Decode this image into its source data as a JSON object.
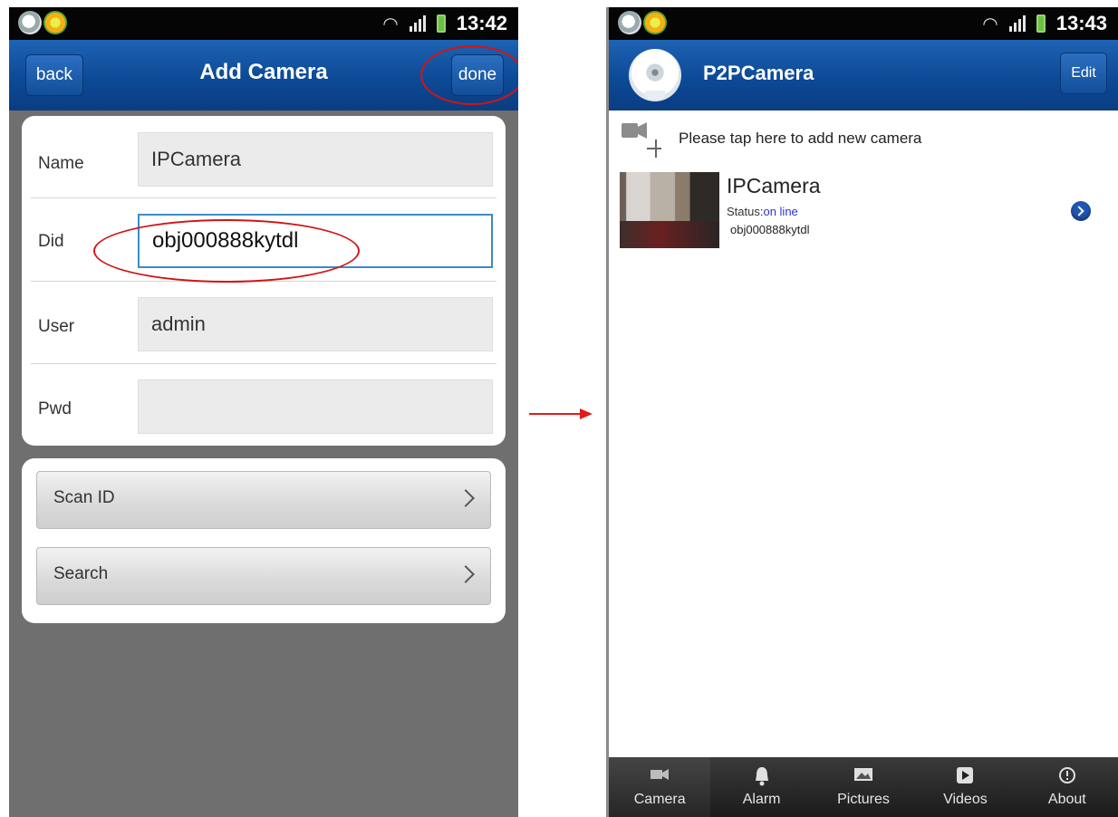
{
  "left_screen": {
    "status_time": "13:42",
    "title": "Add Camera",
    "back_label": "back",
    "done_label": "done",
    "fields": [
      {
        "label": "Name",
        "value": "IPCamera"
      },
      {
        "label": "Did",
        "value": "obj000888kytdl"
      },
      {
        "label": "User",
        "value": "admin"
      },
      {
        "label": "Pwd",
        "value": ""
      }
    ],
    "nav_buttons": [
      {
        "label": "Scan ID"
      },
      {
        "label": "Search"
      }
    ]
  },
  "right_screen": {
    "status_time": "13:43",
    "title": "P2PCamera",
    "edit_label": "Edit",
    "add_prompt": "Please tap here to add new camera",
    "camera": {
      "name": "IPCamera",
      "status_label": "Status:",
      "status_value": "on line",
      "did": "obj000888kytdl"
    },
    "tabs": [
      {
        "label": "Camera",
        "icon": "camera-icon",
        "active": true
      },
      {
        "label": "Alarm",
        "icon": "bell-icon",
        "active": false
      },
      {
        "label": "Pictures",
        "icon": "picture-icon",
        "active": false
      },
      {
        "label": "Videos",
        "icon": "video-icon",
        "active": false
      },
      {
        "label": "About",
        "icon": "info-icon",
        "active": false
      }
    ]
  },
  "colors": {
    "titlebar": "#0d4a96",
    "annotation_red": "#d11515",
    "online_status": "#2a33d8"
  }
}
